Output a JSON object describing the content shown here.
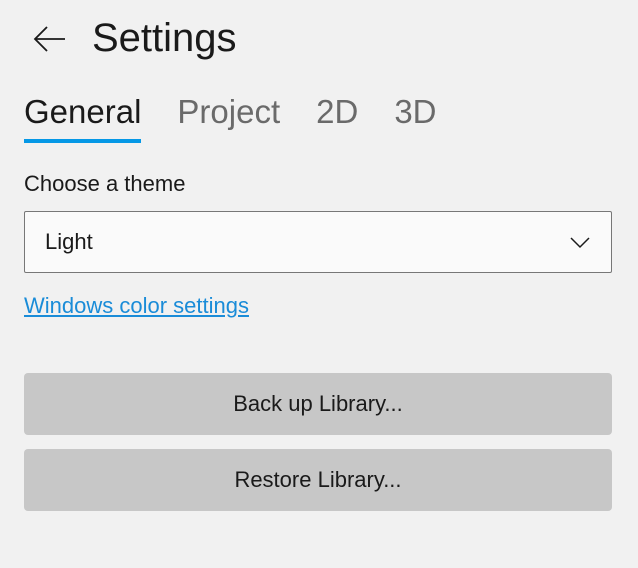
{
  "header": {
    "title": "Settings"
  },
  "tabs": {
    "items": [
      {
        "label": "General",
        "active": true
      },
      {
        "label": "Project",
        "active": false
      },
      {
        "label": "2D",
        "active": false
      },
      {
        "label": "3D",
        "active": false
      }
    ]
  },
  "theme": {
    "field_label": "Choose a theme",
    "selected": "Light"
  },
  "link": {
    "color_settings": "Windows color settings"
  },
  "buttons": {
    "backup": "Back up Library...",
    "restore": "Restore Library..."
  }
}
